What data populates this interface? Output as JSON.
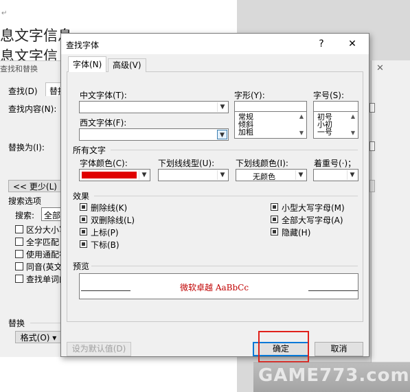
{
  "background": {
    "doc_text": [
      "息文字信息",
      "息文字信"
    ],
    "find_replace": {
      "title": "查找和替换",
      "tabs": [
        "查找(D)",
        "替换"
      ],
      "find_label": "查找内容(N):",
      "replace_label": "替换为(I):",
      "less_button": "<< 更少(L)",
      "search_options": "搜索选项",
      "search_label": "搜索:",
      "search_value": "全部",
      "options": [
        "区分大小写",
        "全字匹配",
        "使用通配符",
        "同音(英文",
        "查找单词的"
      ],
      "replace_group": "替换",
      "format_button": "格式(O) ▾"
    }
  },
  "dialog": {
    "title": "查找字体",
    "help": "?",
    "close": "✕",
    "tabs": [
      "字体(N)",
      "高级(V)"
    ],
    "cn_font_label": "中文字体(T):",
    "cn_font_value": "",
    "west_font_label": "西文字体(F):",
    "west_font_value": "",
    "style_label": "字形(Y):",
    "style_value": "",
    "style_items": [
      "常规",
      "倾斜",
      "加粗"
    ],
    "size_label": "字号(S):",
    "size_value": "",
    "size_items": [
      "初号",
      "小初",
      "一号"
    ],
    "all_text": "所有文字",
    "color_label": "字体颜色(C):",
    "color_value": "#e00000",
    "underline_label": "下划线线型(U):",
    "underline_value": "",
    "ul_color_label": "下划线颜色(I):",
    "ul_color_value": "无颜色",
    "emphasis_label": "着重号(·)；",
    "emphasis_value": "",
    "effects": "效果",
    "effects_left": [
      "删除线(K)",
      "双删除线(L)",
      "上标(P)",
      "下标(B)"
    ],
    "effects_right": [
      "小型大写字母(M)",
      "全部大写字母(A)",
      "隐藏(H)"
    ],
    "preview_label": "预览",
    "preview_text": "微软卓越  AaBbCc",
    "default_button": "设为默认值(D)",
    "ok_button": "确定",
    "cancel_button": "取消"
  },
  "watermark": {
    "text": "GAME773.com",
    "color": "#e8e8e8"
  }
}
